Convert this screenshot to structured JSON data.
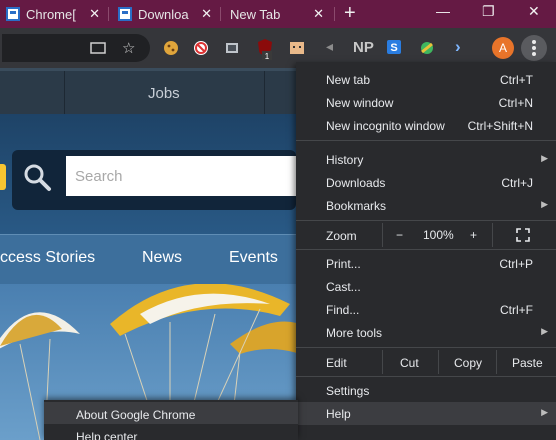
{
  "tabs": [
    {
      "title": "Chrome[",
      "close": "✕"
    },
    {
      "title": "Downloa",
      "close": "✕"
    },
    {
      "title": "New Tab",
      "close": "✕"
    }
  ],
  "new_tab_symbol": "+",
  "window_controls": {
    "minimize": "—",
    "restore": "❐",
    "close": "✕"
  },
  "toolbar": {
    "extension_np": "NP",
    "avatar_initial": "A",
    "extension_badge_count": "1"
  },
  "page": {
    "nav_item": "Jobs",
    "search_placeholder": "Search",
    "nav_links": [
      "ccess Stories",
      "News",
      "Events"
    ]
  },
  "menu": {
    "new_tab": {
      "label": "New tab",
      "shortcut": "Ctrl+T"
    },
    "new_window": {
      "label": "New window",
      "shortcut": "Ctrl+N"
    },
    "new_incognito": {
      "label": "New incognito window",
      "shortcut": "Ctrl+Shift+N"
    },
    "history": {
      "label": "History"
    },
    "downloads": {
      "label": "Downloads",
      "shortcut": "Ctrl+J"
    },
    "bookmarks": {
      "label": "Bookmarks"
    },
    "zoom": {
      "label": "Zoom",
      "minus": "−",
      "level": "100%",
      "plus": "+"
    },
    "print": {
      "label": "Print...",
      "shortcut": "Ctrl+P"
    },
    "cast": {
      "label": "Cast..."
    },
    "find": {
      "label": "Find...",
      "shortcut": "Ctrl+F"
    },
    "more_tools": {
      "label": "More tools"
    },
    "edit": {
      "label": "Edit",
      "cut": "Cut",
      "copy": "Copy",
      "paste": "Paste"
    },
    "settings": {
      "label": "Settings"
    },
    "help": {
      "label": "Help"
    }
  },
  "help_submenu": {
    "about": "About Google Chrome",
    "help_center": "Help center"
  },
  "colors": {
    "tabstrip": "#651a44",
    "toolbar": "#35363a",
    "menu_bg": "#292a2d",
    "menu_highlight": "#3c3d41",
    "avatar": "#e8742a"
  }
}
